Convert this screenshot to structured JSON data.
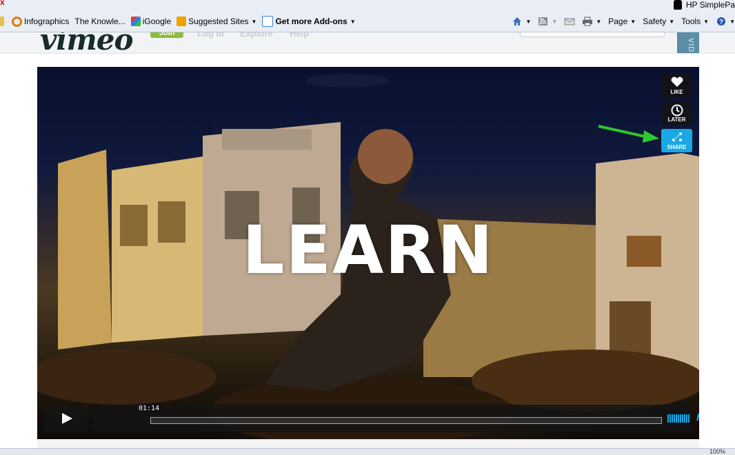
{
  "browser": {
    "tab_title": "HP SimplePa",
    "favorites": [
      {
        "label": "Infographics",
        "icon": "infographics-icon",
        "color": "#e07b00"
      },
      {
        "label": "The Knowle...",
        "icon": "",
        "color": ""
      },
      {
        "label": "iGoogle",
        "icon": "igoogle-icon",
        "color": "#3b7ddd"
      },
      {
        "label": "Suggested Sites",
        "icon": "suggested-sites-icon",
        "color": "#f0a000",
        "dropdown": true
      },
      {
        "label": "Get more Add-ons",
        "icon": "addons-icon",
        "color": "#3b7ddd",
        "dropdown": true,
        "bold": true
      }
    ],
    "commands": {
      "page": "Page",
      "safety": "Safety",
      "tools": "Tools"
    }
  },
  "site": {
    "logo": "vimeo",
    "join": "Join",
    "nav": [
      "Log In",
      "Explore",
      "Help"
    ],
    "search_placeholder": "",
    "side_tab": "VIDEOS"
  },
  "player": {
    "overlay_title": "LEARN",
    "side_buttons": [
      {
        "label": "LIKE",
        "icon": "heart-icon"
      },
      {
        "label": "LATER",
        "icon": "clock-icon"
      },
      {
        "label": "SHARE",
        "icon": "share-icon"
      }
    ],
    "time": "01:14",
    "hd": "HD",
    "accent": "#1aa7e6",
    "annotation_arrow_color": "#2ec72e"
  },
  "status": {
    "zoom": "100%"
  }
}
